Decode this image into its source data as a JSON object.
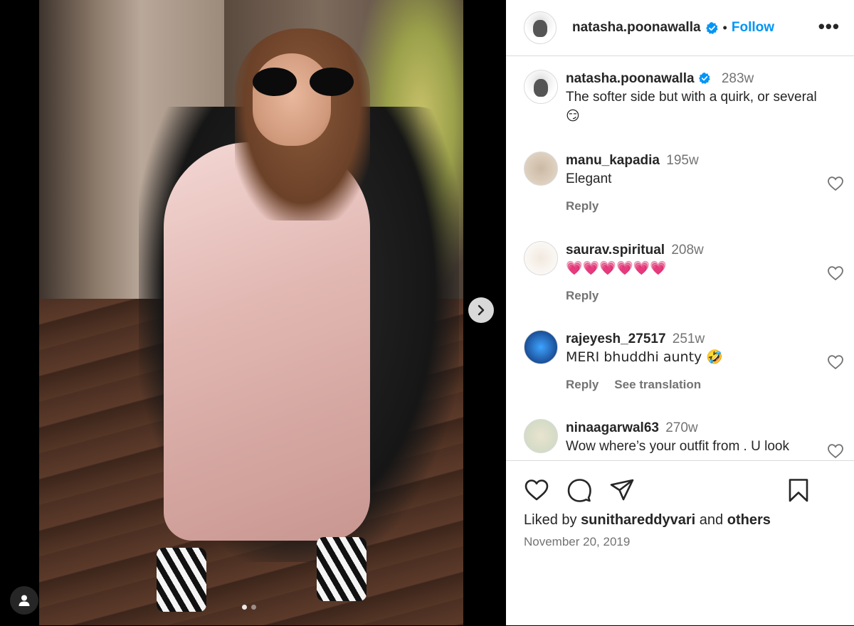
{
  "post": {
    "owner": "natasha.poonawalla",
    "follow_label": "Follow",
    "separator": "•",
    "more_label": "•••",
    "caption": {
      "username": "natasha.poonawalla",
      "time": "283w",
      "text": "The softer side but with a quirk, or several",
      "emoji": "😏"
    },
    "comments": [
      {
        "username": "manu_kapadia",
        "time": "195w",
        "text": "Elegant",
        "actions": [
          "Reply"
        ]
      },
      {
        "username": "saurav.spiritual",
        "time": "208w",
        "text": "💗💗💗💗💗💗",
        "actions": [
          "Reply"
        ]
      },
      {
        "username": "rajeyesh_27517",
        "time": "251w",
        "text": "MERI bhuddhi aunty 🤣",
        "actions": [
          "Reply",
          "See translation"
        ]
      },
      {
        "username": "ninaagarwal63",
        "time": "270w",
        "text": "Wow where’s your outfit from . U look",
        "actions": []
      }
    ],
    "likes_prefix": "Liked by",
    "liked_by_user": "sunithareddyvari",
    "likes_and": "and",
    "likes_others": "others",
    "date": "November 20, 2019"
  },
  "media": {
    "carousel_count": 2,
    "carousel_index": 0,
    "icons": {
      "next": "chevron-right-icon",
      "tag": "user-tag-icon"
    }
  },
  "colors": {
    "accent": "#0095f6",
    "text": "#262626",
    "muted": "#737373",
    "border": "#dbdbdb"
  }
}
